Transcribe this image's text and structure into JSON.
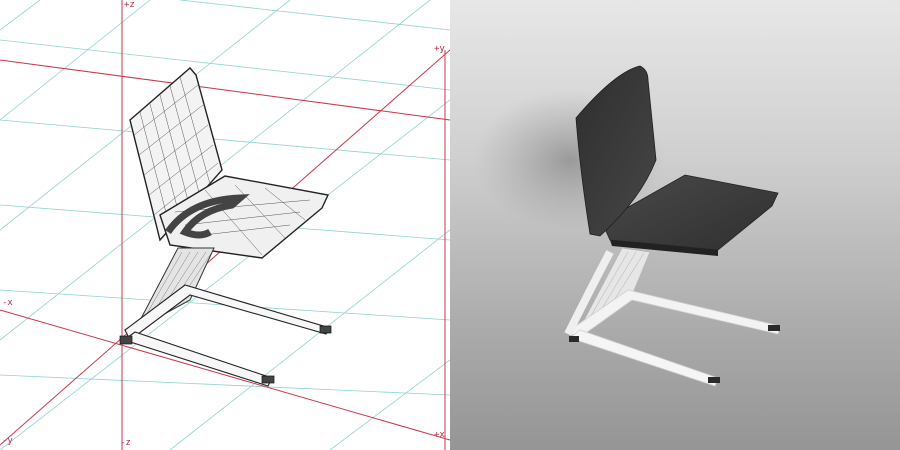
{
  "viewport": {
    "wireframe": {
      "axis_labels": {
        "plus_z": "+z",
        "plus_y": "+y",
        "minus_x": "-x",
        "minus_z": "-z",
        "minus_y": "-y",
        "plus_x": "+x"
      },
      "model": "chair-wireframe"
    },
    "render": {
      "model": "chair-rendered"
    }
  },
  "colors": {
    "axis_red": "#c03040",
    "grid_cyan": "#7cc8c8",
    "wire_dark": "#333333",
    "seat_fabric": "#3a3a3a",
    "frame_white": "#f2f2f2"
  }
}
